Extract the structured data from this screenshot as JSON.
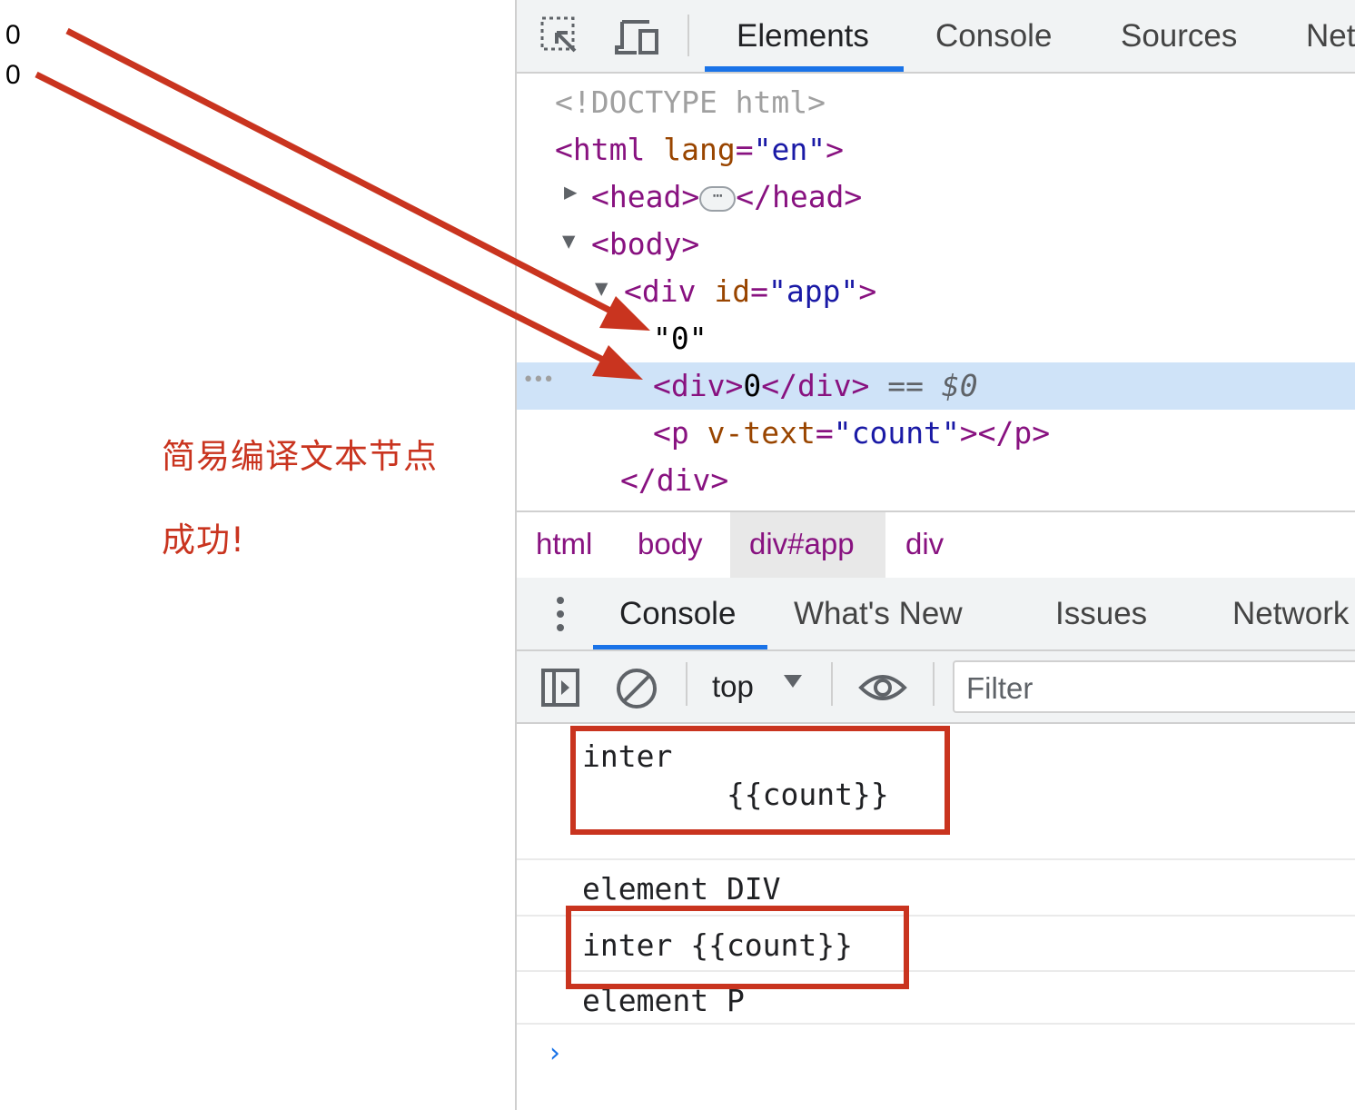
{
  "page": {
    "numbers": [
      "0",
      "0"
    ],
    "annotation_lines": [
      "简易编译文本节点",
      "成功!"
    ]
  },
  "devtools": {
    "top_tabs": [
      "Elements",
      "Console",
      "Sources",
      "Net"
    ],
    "active_tab": "Elements",
    "dom": {
      "doctype": "<!DOCTYPE html>",
      "html_open": "<html",
      "html_attr": "lang",
      "html_attr_value": "\"en\"",
      "html_close": ">",
      "head_open": "<head>",
      "head_close": "</head>",
      "body_open": "<body>",
      "div_open": "<div",
      "div_attr": "id",
      "div_attr_value": "\"app\"",
      "div_open_end": ">",
      "text_node": "\"0\"",
      "selected_div_open": "<div>",
      "selected_div_text": "0",
      "selected_div_close": "</div>",
      "selected_marker": " == $0",
      "p_open": "<p",
      "p_attr": "v-text",
      "p_attr_value": "\"count\"",
      "p_close": "></p>",
      "div_close": "</div>",
      "row_ellipsis": "•••"
    },
    "breadcrumbs": [
      "html",
      "body",
      "div#app",
      "div"
    ],
    "drawer_tabs": [
      "Console",
      "What's New",
      "Issues",
      "Network"
    ],
    "console_toolbar": {
      "context": "top",
      "filter_placeholder": "Filter"
    },
    "console_messages": [
      "inter",
      "        {{count}}",
      "element DIV",
      "inter {{count}}",
      "element P"
    ],
    "prompt_symbol": "›"
  },
  "colors": {
    "annotation_red": "#c9341f",
    "tag_purple": "#881280",
    "attr_brown": "#994500",
    "value_blue": "#1a1aa6",
    "accent_blue": "#1a73e8",
    "selected_row": "#cfe3f8"
  }
}
